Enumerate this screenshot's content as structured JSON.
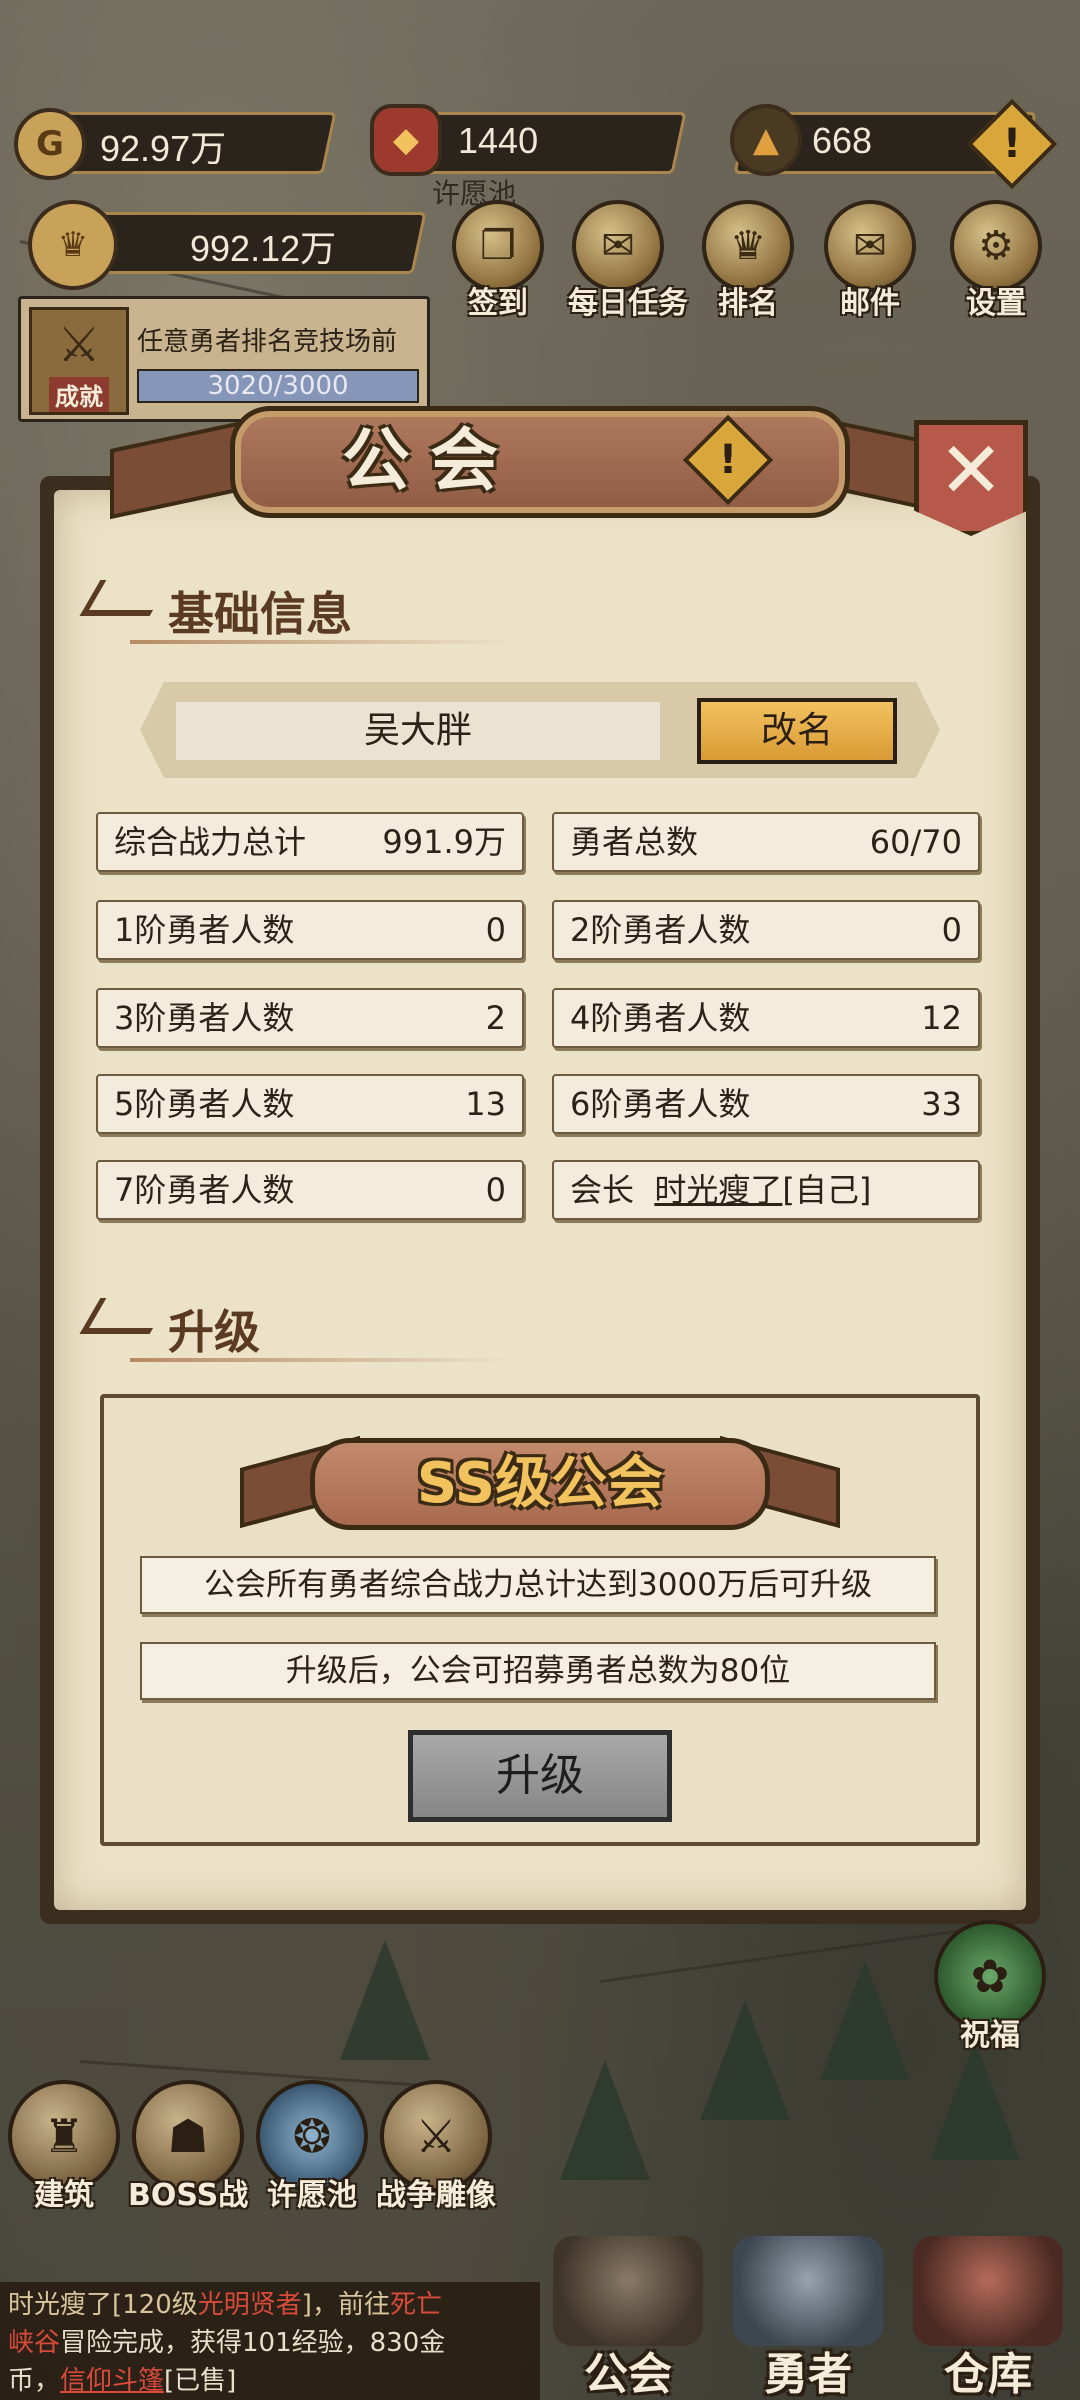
{
  "resources": {
    "gold": "92.97万",
    "medal": "1440",
    "ore": "668",
    "power": "992.12万"
  },
  "top_buttons": [
    {
      "label": "签到",
      "icon": "book-icon"
    },
    {
      "label": "每日任务",
      "icon": "scroll-icon"
    },
    {
      "label": "排名",
      "icon": "crown-icon"
    },
    {
      "label": "邮件",
      "icon": "envelope-icon"
    },
    {
      "label": "设置",
      "icon": "gear-icon"
    }
  ],
  "map_label": "许愿池",
  "achievement": {
    "badge_label": "成就",
    "task": "任意勇者排名竞技场前",
    "progress_text": "3020/3000",
    "progress_fraction": 1.0
  },
  "dialog": {
    "title": "公会",
    "alert_mark": "!",
    "close_mark": "✕",
    "basic_info_title": "基础信息",
    "guild_name": "吴大胖",
    "rename_label": "改名",
    "stats": [
      {
        "key": "综合战力总计",
        "value": "991.9万"
      },
      {
        "key": "勇者总数",
        "value": "60/70"
      },
      {
        "key": "1阶勇者人数",
        "value": "0"
      },
      {
        "key": "2阶勇者人数",
        "value": "0"
      },
      {
        "key": "3阶勇者人数",
        "value": "2"
      },
      {
        "key": "4阶勇者人数",
        "value": "12"
      },
      {
        "key": "5阶勇者人数",
        "value": "13"
      },
      {
        "key": "6阶勇者人数",
        "value": "33"
      },
      {
        "key": "7阶勇者人数",
        "value": "0"
      }
    ],
    "leader": {
      "key": "会长",
      "name": "时光瘦了",
      "suffix": "[自己]"
    },
    "upgrade_title": "升级",
    "rank_label": "SS级公会",
    "upgrade_requirement": "公会所有勇者综合战力总计达到3000万后可升级",
    "upgrade_benefit": "升级后，公会可招募勇者总数为80位",
    "upgrade_button": "升级"
  },
  "bottom_buttons": [
    {
      "label": "建筑",
      "icon": "castle-icon"
    },
    {
      "label": "BOSS战",
      "icon": "helmet-icon"
    },
    {
      "label": "许愿池",
      "icon": "fountain-icon"
    },
    {
      "label": "战争雕像",
      "icon": "statue-icon"
    }
  ],
  "bless_label": "祝福",
  "log": {
    "line1_pre": "时光瘦了[120级",
    "line1_hl": "光明贤者",
    "line1_mid": "]，前往",
    "line1_place": "死亡",
    "line2_place": "峡谷",
    "line2_rest": "冒险完成，获得101经验，830金",
    "line3_pre": "币，",
    "line3_item": "信仰斗篷",
    "line3_post": "[已售]"
  },
  "nav_tabs": [
    {
      "label": "公会"
    },
    {
      "label": "勇者"
    },
    {
      "label": "仓库"
    }
  ],
  "colors": {
    "parchment": "#ece2c8",
    "frame": "#3b2e1f",
    "rename_gold": "#f2c260",
    "rank_gold": "#f2c25e",
    "disabled_gray": "#a9a9a9"
  }
}
